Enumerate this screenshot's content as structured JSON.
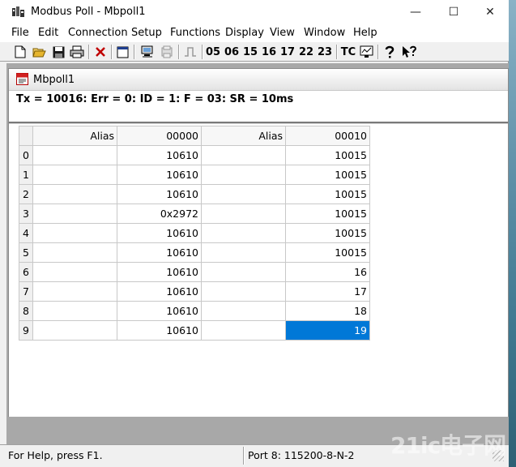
{
  "window": {
    "title": "Modbus Poll - Mbpoll1",
    "controls": {
      "minimize": "—",
      "maximize": "☐",
      "close": "✕"
    }
  },
  "menu": [
    "File",
    "Edit",
    "Connection",
    "Setup",
    "Functions",
    "Display",
    "View",
    "Window",
    "Help"
  ],
  "toolbar": {
    "function_codes": [
      "05",
      "06",
      "15",
      "16",
      "17",
      "22",
      "23"
    ],
    "tc_label": "TC",
    "icons": [
      "new-icon",
      "open-icon",
      "save-icon",
      "print-icon",
      "delete-icon",
      "window-icon",
      "connect-icon",
      "disconnect-icon",
      "pulse-icon",
      "monitor-icon",
      "help-icon",
      "context-help-icon"
    ]
  },
  "child_window": {
    "title": "Mbpoll1",
    "status": "Tx = 10016: Err = 0: ID = 1: F = 03: SR = 10ms"
  },
  "grid": {
    "headers": [
      "Alias",
      "00000",
      "Alias",
      "00010"
    ],
    "rows": [
      {
        "index": "0",
        "alias1": "",
        "value1": "10610",
        "alias2": "",
        "value2": "10015"
      },
      {
        "index": "1",
        "alias1": "",
        "value1": "10610",
        "alias2": "",
        "value2": "10015"
      },
      {
        "index": "2",
        "alias1": "",
        "value1": "10610",
        "alias2": "",
        "value2": "10015"
      },
      {
        "index": "3",
        "alias1": "",
        "value1": "0x2972",
        "alias2": "",
        "value2": "10015"
      },
      {
        "index": "4",
        "alias1": "",
        "value1": "10610",
        "alias2": "",
        "value2": "10015"
      },
      {
        "index": "5",
        "alias1": "",
        "value1": "10610",
        "alias2": "",
        "value2": "10015"
      },
      {
        "index": "6",
        "alias1": "",
        "value1": "10610",
        "alias2": "",
        "value2": "16"
      },
      {
        "index": "7",
        "alias1": "",
        "value1": "10610",
        "alias2": "",
        "value2": "17"
      },
      {
        "index": "8",
        "alias1": "",
        "value1": "10610",
        "alias2": "",
        "value2": "18"
      },
      {
        "index": "9",
        "alias1": "",
        "value1": "10610",
        "alias2": "",
        "value2": "19"
      }
    ],
    "selected_row": 9,
    "selection_color": "#0078d7"
  },
  "statusbar": {
    "help_text": "For Help, press F1.",
    "port_text": "Port 8: 115200-8-N-2"
  },
  "watermark": "21ic电子网"
}
